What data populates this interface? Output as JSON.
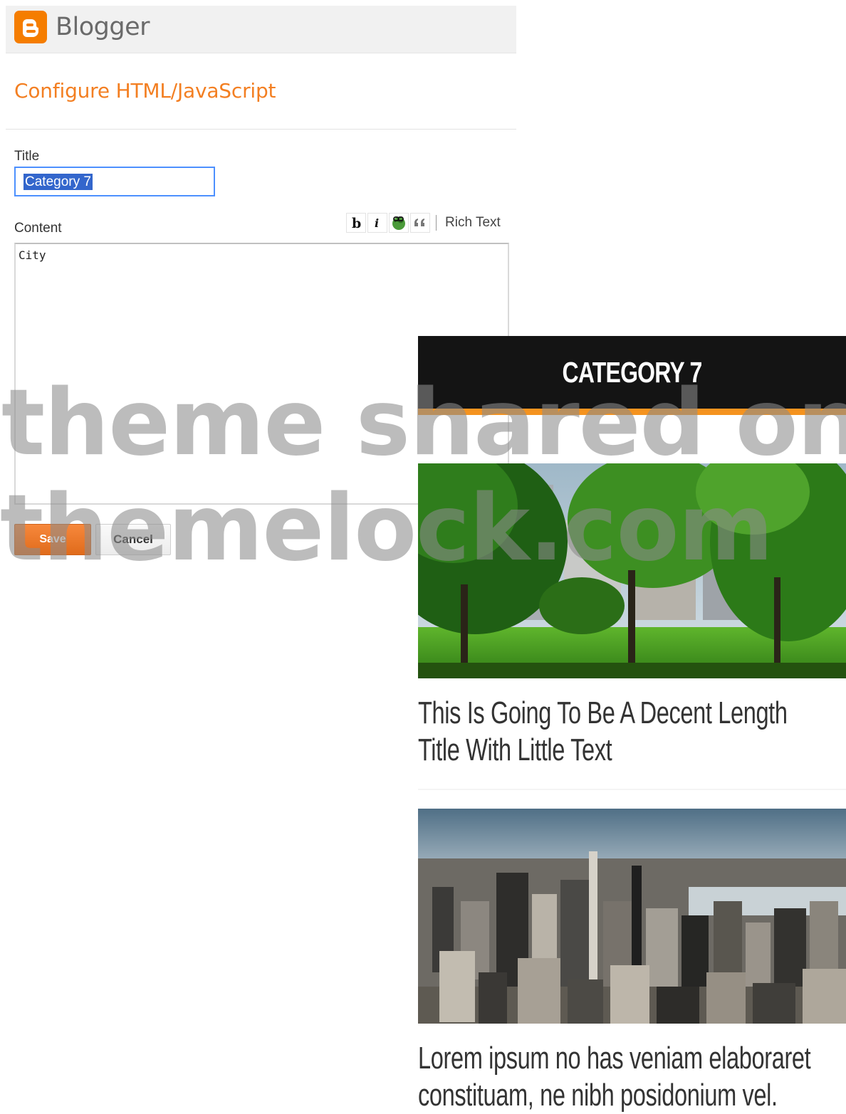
{
  "app": {
    "brand": "Blogger"
  },
  "dialog": {
    "heading": "Configure HTML/JavaScript",
    "title_label": "Title",
    "title_value": "Category 7",
    "content_label": "Content",
    "content_value": "City",
    "toolbar": {
      "buttons": [
        "bold-icon",
        "italic-icon",
        "link-icon",
        "quote-icon"
      ],
      "rich_text_label": "Rich Text"
    },
    "save_label": "Save",
    "cancel_label": "Cancel"
  },
  "widget_preview": {
    "heading": "CATEGORY 7",
    "posts": [
      {
        "title": "This Is Going To Be A Decent Length Title With Little Text",
        "image": "city-park-image"
      },
      {
        "title": "Lorem ipsum no has veniam elaboraret constituam, ne nibh posidonium vel.",
        "image": "city-skyline-image"
      }
    ]
  },
  "watermark": {
    "line1": "theme shared on",
    "line2": "themelock.com"
  },
  "colors": {
    "brand_orange": "#f37f22",
    "widget_header_bg": "#141414",
    "widget_accent": "#f5931f",
    "selection_blue": "#3366cc",
    "focus_border": "#4d90fe"
  }
}
